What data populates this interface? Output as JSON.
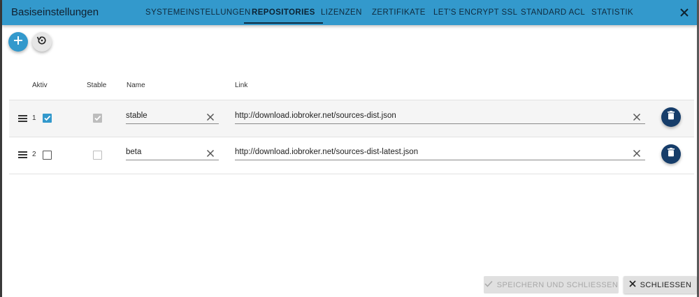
{
  "dialog": {
    "title": "Basiseinstellungen",
    "tabs": [
      {
        "label": "SYSTEMEINSTELLUNGEN"
      },
      {
        "label": "REPOSITORIES"
      },
      {
        "label": "LIZENZEN"
      },
      {
        "label": "ZERTIFIKATE"
      },
      {
        "label": "LET'S ENCRYPT SSL"
      },
      {
        "label": "STANDARD ACL"
      },
      {
        "label": "STATISTIK"
      }
    ],
    "active_tab": "REPOSITORIES"
  },
  "toolbar": {
    "add_icon": "plus-icon",
    "reset_icon": "restore-icon"
  },
  "table": {
    "headers": {
      "active": "Aktiv",
      "stable": "Stable",
      "name": "Name",
      "link": "Link"
    },
    "rows": [
      {
        "index": "1",
        "active": true,
        "stable": true,
        "name": "stable",
        "link": "http://download.iobroker.net/sources-dist.json"
      },
      {
        "index": "2",
        "active": false,
        "stable": false,
        "name": "beta",
        "link": "http://download.iobroker.net/sources-dist-latest.json"
      }
    ]
  },
  "footer": {
    "save_label": "SPEICHERN UND SCHLIESSEN",
    "close_label": "SCHLIESSEN"
  },
  "colors": {
    "appbar": "#3399cc",
    "delete_button": "#163d6a",
    "checkbox_checked": "#3399cc"
  }
}
